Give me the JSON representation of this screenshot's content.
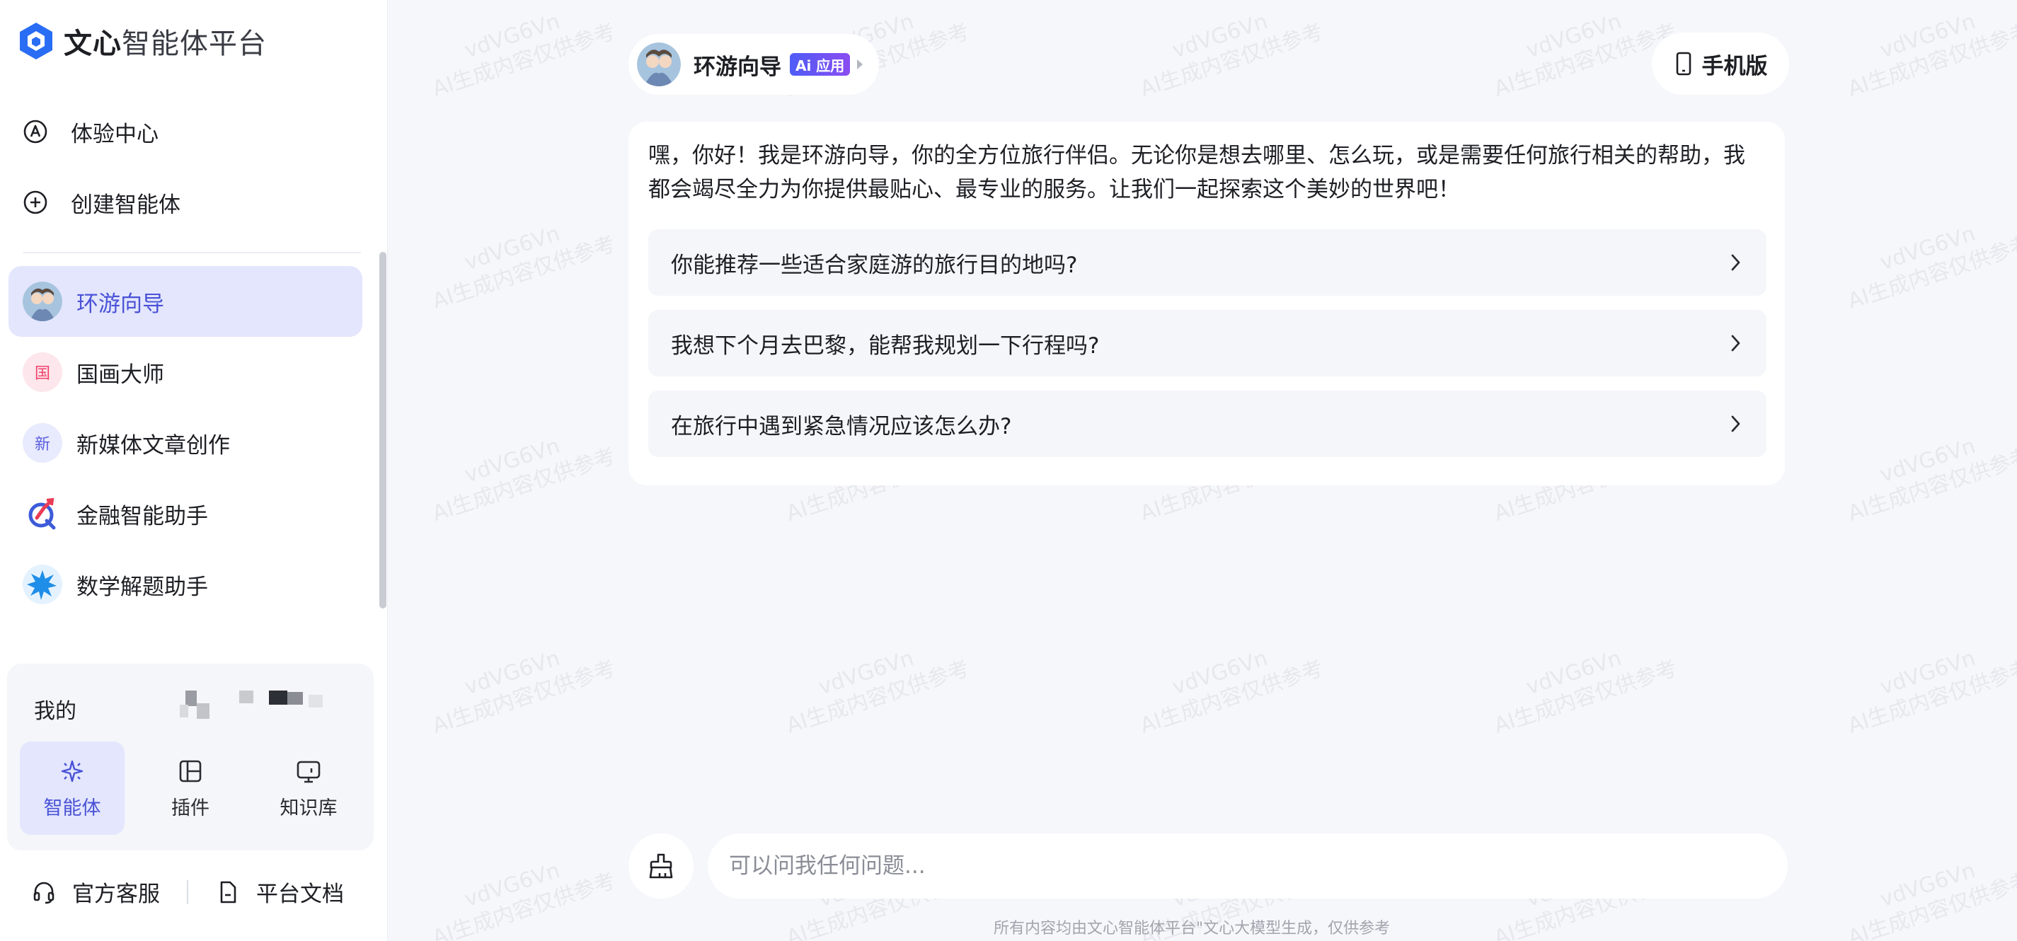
{
  "app": {
    "logo_text_bold": "文心",
    "logo_text_rest": "智能体平台"
  },
  "nav": {
    "experience_center": "体验中心",
    "create_agent": "创建智能体"
  },
  "agents": [
    {
      "label": "环游向导",
      "icon": "travel-avatar",
      "active": true
    },
    {
      "label": "国画大师",
      "icon_text": "国",
      "icon_color": "#f0436a",
      "icon_bg": "#fde6ec"
    },
    {
      "label": "新媒体文章创作",
      "icon_text": "新",
      "icon_color": "#5a5ee0",
      "icon_bg": "#e8eafd"
    },
    {
      "label": "金融智能助手",
      "icon": "finance-icon"
    },
    {
      "label": "数学解题助手",
      "icon": "math-burst-icon"
    }
  ],
  "my_panel": {
    "title": "我的",
    "tabs": [
      {
        "label": "智能体",
        "icon": "sparkle-icon",
        "active": true
      },
      {
        "label": "插件",
        "icon": "plugin-icon"
      },
      {
        "label": "知识库",
        "icon": "monitor-icon"
      }
    ]
  },
  "footer": {
    "support": "官方客服",
    "docs": "平台文档"
  },
  "header": {
    "agent_name": "环游向导",
    "ai_badge": "Ai 应用",
    "mobile_button": "手机版"
  },
  "welcome": {
    "greeting": "嘿，你好！我是环游向导，你的全方位旅行伴侣。无论你是想去哪里、怎么玩，或是需要任何旅行相关的帮助，我都会竭尽全力为你提供最贴心、最专业的服务。让我们一起探索这个美妙的世界吧！",
    "suggestions": [
      "你能推荐一些适合家庭游的旅行目的地吗?",
      "我想下个月去巴黎，能帮我规划一下行程吗?",
      "在旅行中遇到紧急情况应该怎么办?"
    ]
  },
  "input": {
    "placeholder": "可以问我任何问题..."
  },
  "disclaimer": "所有内容均由文心智能体平台\"文心大模型生成，仅供参考",
  "watermark": {
    "line1": "vdVG6Vn",
    "line2": "AI生成内容仅供参考"
  },
  "colors": {
    "accent": "#4a52d6",
    "active_bg": "#e3e6fd",
    "page_bg": "#f6f7fb"
  }
}
